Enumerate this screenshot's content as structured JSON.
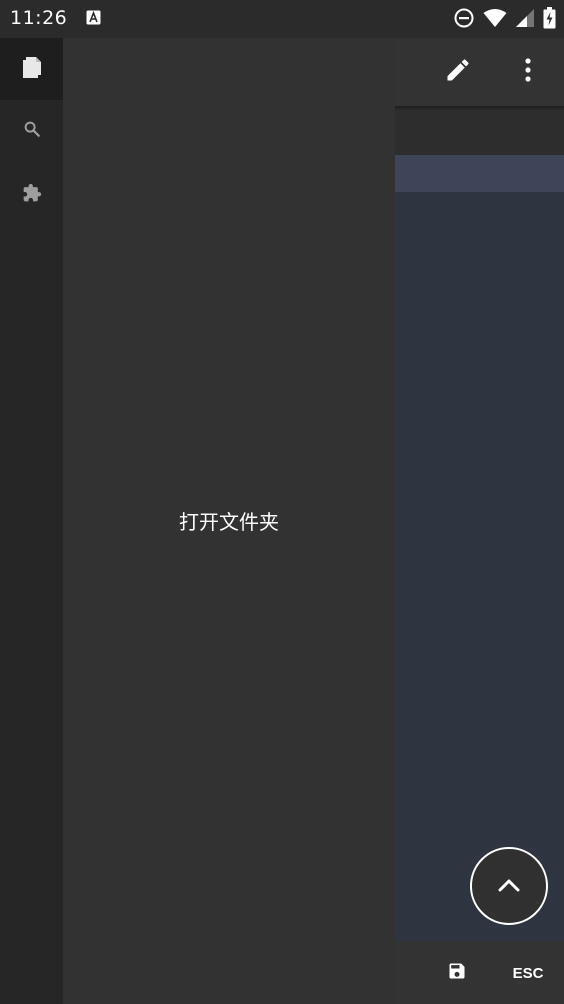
{
  "status_bar": {
    "time": "11:26",
    "icons": [
      "accessibility-a-icon",
      "do-not-disturb-icon",
      "wifi-icon",
      "cellular-signal-icon",
      "battery-charging-icon"
    ]
  },
  "toolbar": {
    "icons": [
      "edit-pencil-icon",
      "more-vert-icon"
    ]
  },
  "side_rail": {
    "items": [
      {
        "icon": "files-icon",
        "active": true
      },
      {
        "icon": "search-icon",
        "active": false
      },
      {
        "icon": "extension-puzzle-icon",
        "active": false
      }
    ]
  },
  "drawer": {
    "open_folder_label": "打开文件夹"
  },
  "fab": {
    "icon": "chevron-up-icon"
  },
  "bottom_bar": {
    "save_icon": "save-floppy-icon",
    "esc_label": "ESC"
  },
  "colors": {
    "editor_background": "#2f3441",
    "editor_current_line": "#3e4559",
    "drawer_background": "#323232",
    "rail_background": "#262626",
    "text": "#ffffff"
  }
}
